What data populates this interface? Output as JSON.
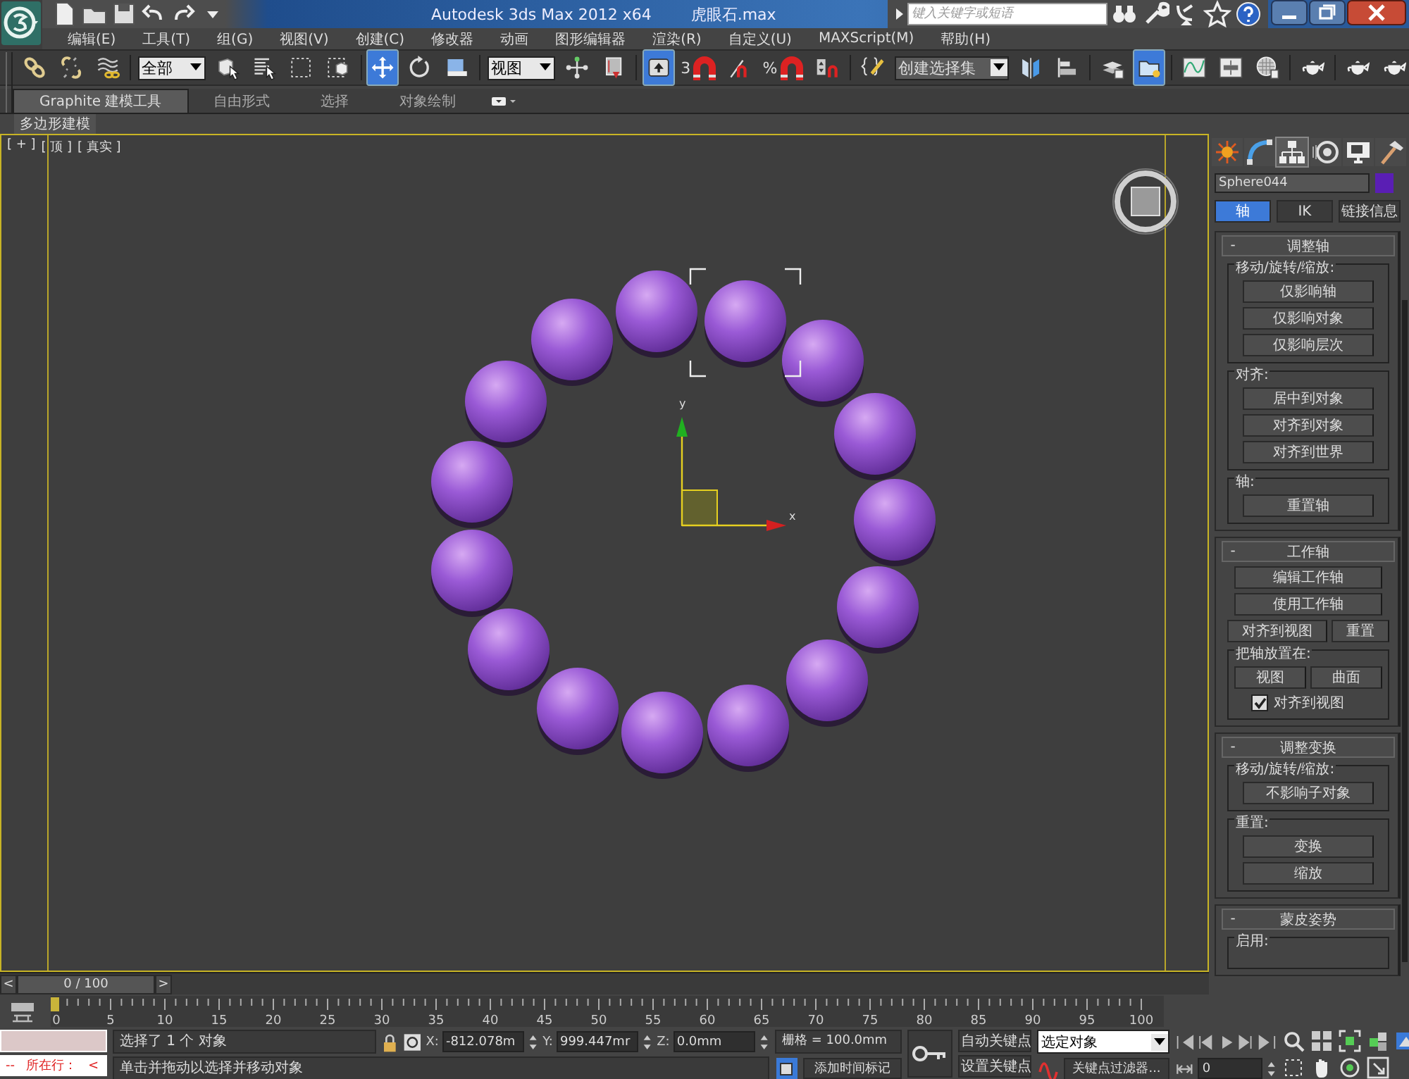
{
  "title_bar": {
    "title": "Autodesk 3ds Max  2012 x64",
    "file": "虎眼石.max",
    "search": {
      "placeholder": "键入关键字或短语"
    }
  },
  "menu": [
    "编辑(E)",
    "工具(T)",
    "组(G)",
    "视图(V)",
    "创建(C)",
    "修改器",
    "动画",
    "图形编辑器",
    "渲染(R)",
    "自定义(U)",
    "MAXScript(M)",
    "帮助(H)"
  ],
  "toolbar": [
    {
      "kind": "link",
      "selected": false
    },
    {
      "kind": "unlink",
      "selected": false
    },
    {
      "kind": "bind",
      "selected": false
    },
    {
      "kind": "dropdown",
      "value": "全部"
    },
    {
      "kind": "select",
      "selected": false
    },
    {
      "kind": "select-name",
      "selected": false
    },
    {
      "kind": "region",
      "selected": false
    },
    {
      "kind": "window",
      "selected": false
    },
    {
      "kind": "move",
      "selected": true
    },
    {
      "kind": "rotate",
      "selected": false
    },
    {
      "kind": "scale",
      "selected": false
    },
    {
      "kind": "dropdown",
      "value": "视图"
    },
    {
      "kind": "pivot",
      "selected": false
    },
    {
      "kind": "manipulate",
      "selected": false
    },
    {
      "kind": "keyboard",
      "selected": true
    },
    {
      "kind": "snap",
      "label": "3"
    },
    {
      "kind": "angle-snap",
      "selected": false
    },
    {
      "kind": "snap",
      "label": "%"
    },
    {
      "kind": "spinner-snap",
      "selected": false
    },
    {
      "kind": "named-edit",
      "selected": false
    },
    {
      "kind": "dropdown",
      "value": "创建选择集"
    },
    {
      "kind": "mirror",
      "selected": false
    },
    {
      "kind": "align",
      "selected": false
    },
    {
      "kind": "layers",
      "selected": false
    },
    {
      "kind": "explorer",
      "selected": true
    },
    {
      "kind": "curve",
      "selected": false
    },
    {
      "kind": "schematic",
      "selected": false
    },
    {
      "kind": "material",
      "selected": false
    },
    {
      "kind": "teapot",
      "selected": false
    },
    {
      "kind": "teapot",
      "selected": false
    },
    {
      "kind": "teapot",
      "selected": false
    }
  ],
  "ribbon": {
    "tabs": [
      {
        "label": "Graphite 建模工具",
        "selected": true
      },
      {
        "label": "自由形式",
        "selected": false
      },
      {
        "label": "选择",
        "selected": false
      },
      {
        "label": "对象绘制",
        "selected": false
      }
    ],
    "panel_label": "多边形建模"
  },
  "viewport": {
    "labels": [
      "[ + ]",
      "[ 顶 ]",
      "[ 真实 ]"
    ],
    "axis_x": "x",
    "axis_y": "y"
  },
  "command_panel": {
    "tabs": [
      {
        "kind": "create",
        "selected": false
      },
      {
        "kind": "modify",
        "selected": false
      },
      {
        "kind": "hierarchy",
        "selected": true
      },
      {
        "kind": "motion",
        "selected": false
      },
      {
        "kind": "display",
        "selected": false
      },
      {
        "kind": "utilities",
        "selected": false
      }
    ],
    "object": {
      "name": "Sphere044",
      "color": "#5a1eb4"
    },
    "subtabs": [
      {
        "label": "轴",
        "selected": true
      },
      {
        "label": "IK",
        "selected": false
      },
      {
        "label": "链接信息",
        "selected": false
      }
    ],
    "rollouts": [
      {
        "toggle": "-",
        "title": "调整轴",
        "content": [
          {
            "kind": "group",
            "title": "移动/旋转/缩放:",
            "children": [
              {
                "kind": "button",
                "label": "仅影响轴"
              },
              {
                "kind": "button",
                "label": "仅影响对象"
              },
              {
                "kind": "button",
                "label": "仅影响层次"
              }
            ]
          },
          {
            "kind": "group",
            "title": "对齐:",
            "children": [
              {
                "kind": "button",
                "label": "居中到对象"
              },
              {
                "kind": "button",
                "label": "对齐到对象"
              },
              {
                "kind": "button",
                "label": "对齐到世界"
              }
            ]
          },
          {
            "kind": "group",
            "title": "轴:",
            "children": [
              {
                "kind": "button",
                "label": "重置轴"
              }
            ]
          }
        ]
      },
      {
        "toggle": "-",
        "title": "工作轴",
        "content": [
          {
            "kind": "button",
            "label": "编辑工作轴"
          },
          {
            "kind": "button",
            "label": "使用工作轴"
          },
          {
            "kind": "row",
            "labels": [
              "对齐到视图",
              "重置"
            ]
          },
          {
            "kind": "group",
            "title": "把轴放置在:",
            "children": [
              {
                "kind": "row",
                "labels": [
                  "视图",
                  "曲面"
                ]
              },
              {
                "kind": "checkbox",
                "label": "对齐到视图",
                "checked": true
              }
            ]
          }
        ]
      },
      {
        "toggle": "-",
        "title": "调整变换",
        "content": [
          {
            "kind": "group",
            "title": "移动/旋转/缩放:",
            "children": [
              {
                "kind": "button",
                "label": "不影响子对象"
              }
            ]
          },
          {
            "kind": "group",
            "title": "重置:",
            "children": [
              {
                "kind": "button",
                "label": "变换"
              },
              {
                "kind": "button",
                "label": "缩放"
              }
            ]
          }
        ]
      },
      {
        "toggle": "-",
        "title": "蒙皮姿势",
        "content": [
          {
            "kind": "group",
            "title": "启用:"
          }
        ]
      }
    ]
  },
  "time_slider": {
    "prev": "<",
    "position": "0 / 100",
    "next": ">",
    "level": 0
  },
  "track_bar": {
    "ticks": [
      "0",
      "5",
      "10",
      "15",
      "20",
      "25",
      "30",
      "35",
      "40",
      "45",
      "50",
      "55",
      "60",
      "65",
      "70",
      "75",
      "80",
      "85",
      "90",
      "95",
      "100"
    ]
  },
  "status": {
    "listener": [
      "--",
      "所在行：",
      "<"
    ],
    "selection_info": "选择了 1 个 对象",
    "prompt": "单击并拖动以选择并移动对象",
    "coords": [
      {
        "label": "X:",
        "value": "-812.078m"
      },
      {
        "label": "Y:",
        "value": "999.447mr"
      },
      {
        "label": "Z:",
        "value": "0.0mm"
      }
    ],
    "grid": "栅格 = 100.0mm",
    "add_time_tag": "添加时间标记",
    "auto_key": "自动关键点",
    "set_key": "设置关键点",
    "key_mode": "选定对象",
    "key_filters": "关键点过滤器...",
    "frame": "0"
  }
}
